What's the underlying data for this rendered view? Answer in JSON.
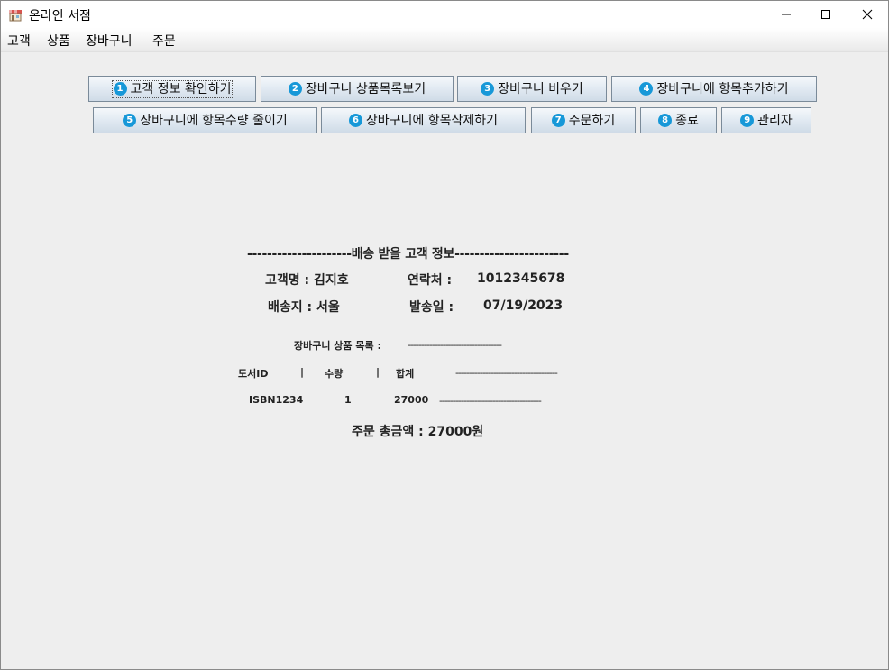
{
  "window": {
    "title": "온라인 서점"
  },
  "menu": [
    "고객",
    "상품",
    "장바구니",
    "주문"
  ],
  "buttons": [
    {
      "num": "1",
      "label": "고객 정보 확인하기"
    },
    {
      "num": "2",
      "label": "장바구니 상품목록보기"
    },
    {
      "num": "3",
      "label": "장바구니 비우기"
    },
    {
      "num": "4",
      "label": "장바구니에 항목추가하기"
    },
    {
      "num": "5",
      "label": "장바구니에 항목수량 줄이기"
    },
    {
      "num": "6",
      "label": "장바구니에 항목삭제하기"
    },
    {
      "num": "7",
      "label": "주문하기"
    },
    {
      "num": "8",
      "label": "종료"
    },
    {
      "num": "9",
      "label": "관리자"
    }
  ],
  "receipt": {
    "header": "---------------------배송 받을 고객 정보-----------------------",
    "customer_label": "고객명 : 김지호",
    "contact_label": "연락처 :",
    "contact_value": "1012345678",
    "address_label": "배송지 : 서울",
    "ship_date_label": "발송일 :",
    "ship_date_value": "07/19/2023",
    "cart_label": "장바구니 상품 목록 :",
    "cart_dashes": "-----------------------------------",
    "col_book_id": "도서ID",
    "col_sep": "|",
    "col_qty": "수량",
    "col_total": "합계",
    "header_dashes": "--------------------------------------",
    "row": {
      "book_id": "ISBN1234",
      "qty": "1",
      "total": "27000",
      "dashes": "--------------------------------------"
    },
    "order_total": "주문 총금액 : 27000원"
  },
  "colors": {
    "badge": "#1798d8",
    "background": "#eeeeee"
  }
}
